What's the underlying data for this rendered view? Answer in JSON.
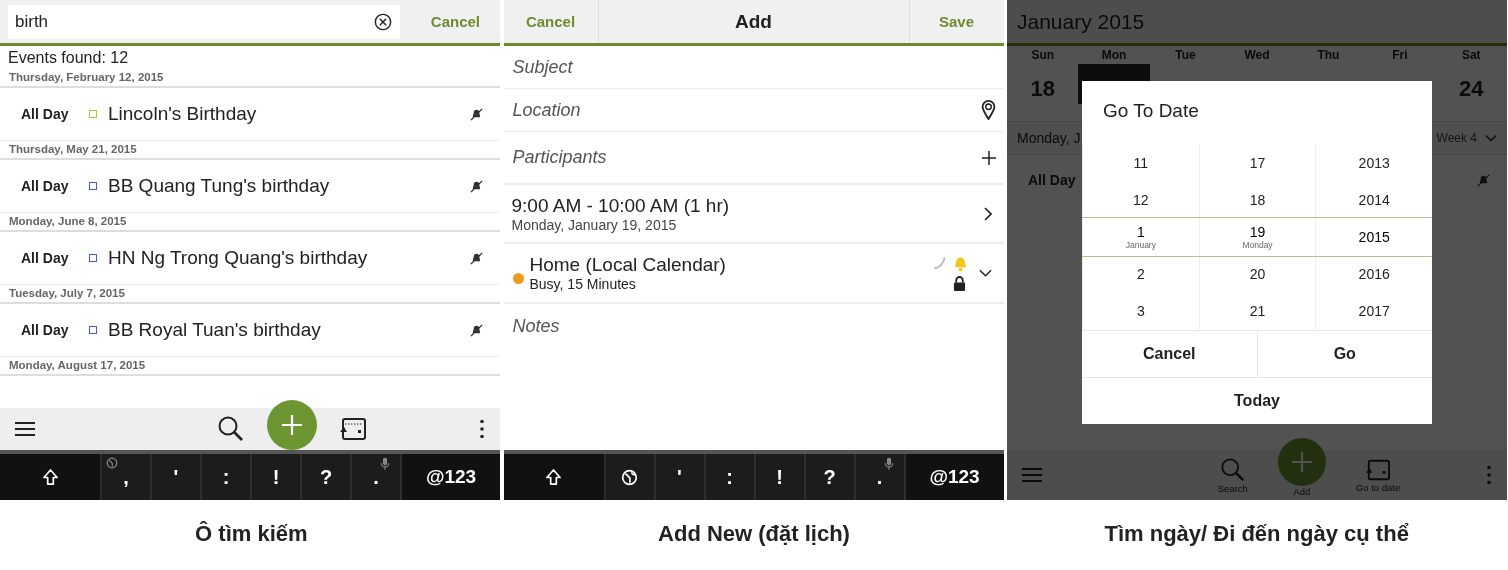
{
  "search_screen": {
    "search": {
      "value": "birth"
    },
    "cancel": "Cancel",
    "events_found": "Events found: 12",
    "groups": [
      {
        "date": "Thursday, February 12, 2015",
        "events": [
          {
            "time": "All Day",
            "title": "Lincoln's Birthday",
            "color": "#a9c23f"
          }
        ]
      },
      {
        "date": "Thursday, May 21, 2015",
        "events": [
          {
            "time": "All Day",
            "title": "BB Quang Tung's birthday",
            "color": "#4b5fa8"
          }
        ]
      },
      {
        "date": "Monday, June 8, 2015",
        "events": [
          {
            "time": "All Day",
            "title": "HN Ng Trong Quang's birthday",
            "color": "#4b5fa8"
          }
        ]
      },
      {
        "date": "Tuesday, July 7, 2015",
        "events": [
          {
            "time": "All Day",
            "title": "BB Royal Tuan's birthday",
            "color": "#4b5fa8"
          }
        ]
      },
      {
        "date": "Monday, August 17, 2015"
      }
    ],
    "toolbar": [
      {
        "kind": "menu"
      },
      {
        "kind": "search"
      },
      {
        "kind": "add"
      },
      {
        "kind": "goto"
      },
      {
        "kind": "more"
      }
    ],
    "keyboard": [
      {
        "kind": "shift"
      },
      {
        "kind": "char_globe",
        "label": ","
      },
      {
        "kind": "char",
        "label": "'"
      },
      {
        "kind": "char",
        "label": ":"
      },
      {
        "kind": "char",
        "label": "!"
      },
      {
        "kind": "char",
        "label": "?"
      },
      {
        "kind": "char_mic",
        "label": "."
      },
      {
        "kind": "wide",
        "label": "@123"
      }
    ]
  },
  "add_screen": {
    "cancel": "Cancel",
    "title": "Add",
    "save": "Save",
    "fields": [
      {
        "kind": "text",
        "placeholder": "Subject"
      },
      {
        "kind": "location",
        "placeholder": "Location"
      },
      {
        "kind": "participants",
        "placeholder": "Participants"
      }
    ],
    "time": {
      "range": "9:00 AM - 10:00 AM (1 hr)",
      "date": "Monday, January 19, 2015"
    },
    "calendar": {
      "name": "Home (Local Calendar)",
      "detail": "Busy, 15 Minutes",
      "color": "#f29a1f"
    },
    "notes": {
      "placeholder": "Notes"
    },
    "keyboard": [
      {
        "kind": "shift"
      },
      {
        "kind": "globe"
      },
      {
        "kind": "char",
        "label": "'"
      },
      {
        "kind": "char",
        "label": ":"
      },
      {
        "kind": "char",
        "label": "!"
      },
      {
        "kind": "char",
        "label": "?"
      },
      {
        "kind": "char_mic",
        "label": "."
      },
      {
        "kind": "wide",
        "label": "@123"
      }
    ]
  },
  "goto_screen": {
    "month": "January 2015",
    "days": [
      {
        "weekday": "Sun",
        "number": "18",
        "selected": false
      },
      {
        "weekday": "Mon",
        "selected": true
      },
      {
        "weekday": "Tue",
        "selected": false
      },
      {
        "weekday": "Wed",
        "selected": false
      },
      {
        "weekday": "Thu",
        "selected": false
      },
      {
        "weekday": "Fri",
        "selected": false
      },
      {
        "weekday": "Sat",
        "number": "24",
        "selected": false
      }
    ],
    "day_label": "Monday, J",
    "week": "Week 4",
    "all_day": "All Day",
    "toolbar": [
      {
        "kind": "menu"
      },
      {
        "kind": "search",
        "label": "Search"
      },
      {
        "kind": "add",
        "label": "Add"
      },
      {
        "kind": "goto",
        "label": "Go to date"
      },
      {
        "kind": "more"
      }
    ],
    "dialog": {
      "title": "Go To Date",
      "columns": [
        [
          {
            "label": "11",
            "selected": false
          },
          {
            "label": "12",
            "selected": false
          },
          {
            "label": "1",
            "sub": "January",
            "selected": true
          },
          {
            "label": "2",
            "selected": false
          },
          {
            "label": "3",
            "selected": false
          }
        ],
        [
          {
            "label": "17",
            "selected": false
          },
          {
            "label": "18",
            "selected": false
          },
          {
            "label": "19",
            "sub": "Monday",
            "selected": true
          },
          {
            "label": "20",
            "selected": false
          },
          {
            "label": "21",
            "selected": false
          }
        ],
        [
          {
            "label": "2013",
            "selected": false
          },
          {
            "label": "2014",
            "selected": false
          },
          {
            "label": "2015",
            "selected": true
          },
          {
            "label": "2016",
            "selected": false
          },
          {
            "label": "2017",
            "selected": false
          }
        ]
      ],
      "cancel": "Cancel",
      "go": "Go",
      "today": "Today"
    }
  },
  "captions": [
    "Ô tìm kiếm",
    "Add New (đặt lịch)",
    "Tìm ngày/ Đi đến ngày cụ thể"
  ]
}
